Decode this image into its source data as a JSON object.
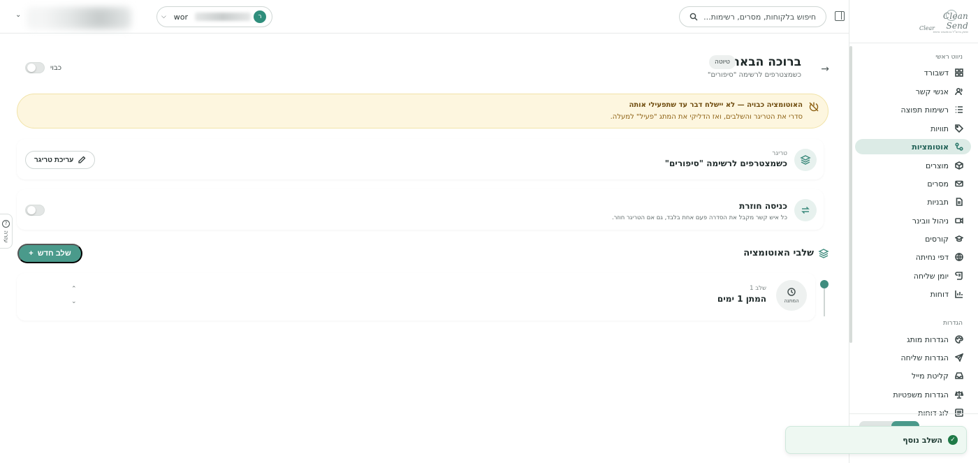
{
  "brand": {
    "logo_main": "Clean Send",
    "logo_small": "Clear",
    "logo_tag": "שיווק בדוא\"ל בהתאמה אישית"
  },
  "topbar": {
    "search_placeholder": "חיפוש בלקוחות, מסרים, רשימות...",
    "account_name": "wor",
    "account_initial": "ר"
  },
  "sidebar": {
    "main_section": "ניווט ראשי",
    "items": [
      {
        "label": "דשבורד",
        "icon": "grid-icon"
      },
      {
        "label": "אנשי קשר",
        "icon": "users-icon"
      },
      {
        "label": "רשימות תפוצה",
        "icon": "list-icon"
      },
      {
        "label": "תוויות",
        "icon": "tag-icon"
      },
      {
        "label": "אוטומציות",
        "icon": "workflow-icon",
        "active": true
      },
      {
        "label": "מוצרים",
        "icon": "box-icon"
      },
      {
        "label": "מסרים",
        "icon": "mail-icon"
      },
      {
        "label": "תבניות",
        "icon": "file-icon"
      },
      {
        "label": "ניהול וובינר",
        "icon": "video-icon"
      },
      {
        "label": "קורסים",
        "icon": "graduation-icon"
      },
      {
        "label": "דפי נחיתה",
        "icon": "globe-icon"
      },
      {
        "label": "יומן שליחה",
        "icon": "scroll-icon"
      },
      {
        "label": "דוחות",
        "icon": "bar-chart-icon"
      }
    ],
    "settings_section": "הגדרות",
    "settings_items": [
      {
        "label": "הגדרות מותג",
        "icon": "palette-icon"
      },
      {
        "label": "הגדרות שליחה",
        "icon": "send-icon"
      },
      {
        "label": "קליטת מייל",
        "icon": "inbox-icon"
      },
      {
        "label": "הגדרות משפטיות",
        "icon": "scale-icon"
      },
      {
        "label": "לוג דוחות",
        "icon": "log-icon"
      }
    ]
  },
  "page": {
    "title": "ברוכה הבאה",
    "status": "טיוטה",
    "subtitle": "כשמצטרפים לרשימה \"סיפורים\"",
    "toggle_label": "כבוי"
  },
  "alert": {
    "title": "האוטומציה כבויה — לא יישלח דבר עד שתפעילי אותה",
    "body": "סדרי את הטריגר והשלבים, ואז הדליקי את המתג \"פעיל\" למעלה."
  },
  "trigger": {
    "label": "טריגר",
    "value": "כשמצטרפים לרשימה \"סיפורים\"",
    "edit_button": "עריכת טריגר"
  },
  "reentry": {
    "label": "כניסה חוזרת",
    "description": "כל איש קשר מקבל את הסדרה פעם אחת בלבד, גם אם הטריגר חוזר."
  },
  "steps": {
    "title": "שלבי האוטומציה",
    "new_step_button": "שלב חדש",
    "items": [
      {
        "number": "שלב 1",
        "label": "המתן 1 ימים",
        "icon_caption": "המתנה"
      }
    ]
  },
  "help_tab": "עזרה",
  "toast": {
    "message": "השלב נוסף"
  },
  "colors": {
    "accent": "#4a9a8b",
    "alert_bg": "#fdf6df",
    "active_nav": "#dcebe6"
  }
}
